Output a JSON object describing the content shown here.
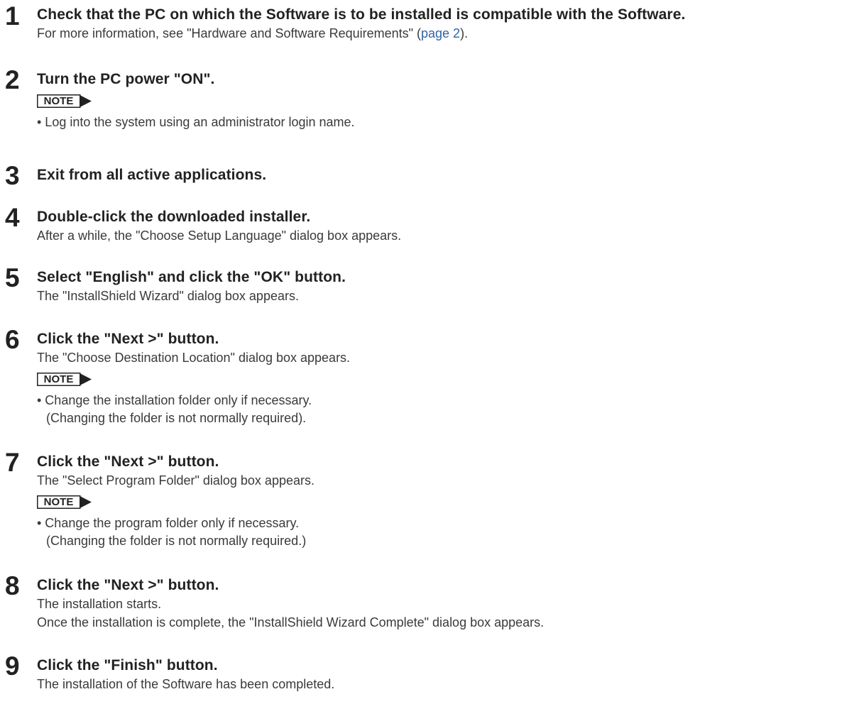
{
  "steps": [
    {
      "number": "1",
      "heading": "Check that the PC on which the Software is to be installed is compatible with the Software.",
      "desc_prefix": "For more information, see \"Hardware and Software Requirements\" (",
      "desc_link": "page 2",
      "desc_suffix": ")."
    },
    {
      "number": "2",
      "heading": "Turn the PC power \"ON\".",
      "note_label": "NOTE",
      "note_lines": [
        "• Log into the system using an administrator login name."
      ]
    },
    {
      "number": "3",
      "heading": "Exit from all active applications."
    },
    {
      "number": "4",
      "heading": "Double-click the downloaded installer.",
      "desc": "After a while, the \"Choose Setup Language\" dialog box appears."
    },
    {
      "number": "5",
      "heading": "Select \"English\" and click the \"OK\" button.",
      "desc": "The \"InstallShield Wizard\" dialog box appears."
    },
    {
      "number": "6",
      "heading": "Click the \"Next >\" button.",
      "desc": "The \"Choose Destination Location\" dialog box appears.",
      "note_label": "NOTE",
      "note_lines": [
        "• Change the installation folder only if necessary.",
        "(Changing the folder is not normally required)."
      ]
    },
    {
      "number": "7",
      "heading": "Click the \"Next >\" button.",
      "desc": "The \"Select Program Folder\" dialog box appears.",
      "note_label": "NOTE",
      "note_lines": [
        "• Change the program folder only if necessary.",
        "(Changing the folder is not normally required.)"
      ]
    },
    {
      "number": "8",
      "heading": "Click the \"Next >\" button.",
      "desc": "The installation starts.",
      "desc2": "Once the installation is complete, the \"InstallShield Wizard Complete\" dialog box appears."
    },
    {
      "number": "9",
      "heading": "Click the \"Finish\" button.",
      "desc": "The installation of the Software has been completed."
    }
  ]
}
